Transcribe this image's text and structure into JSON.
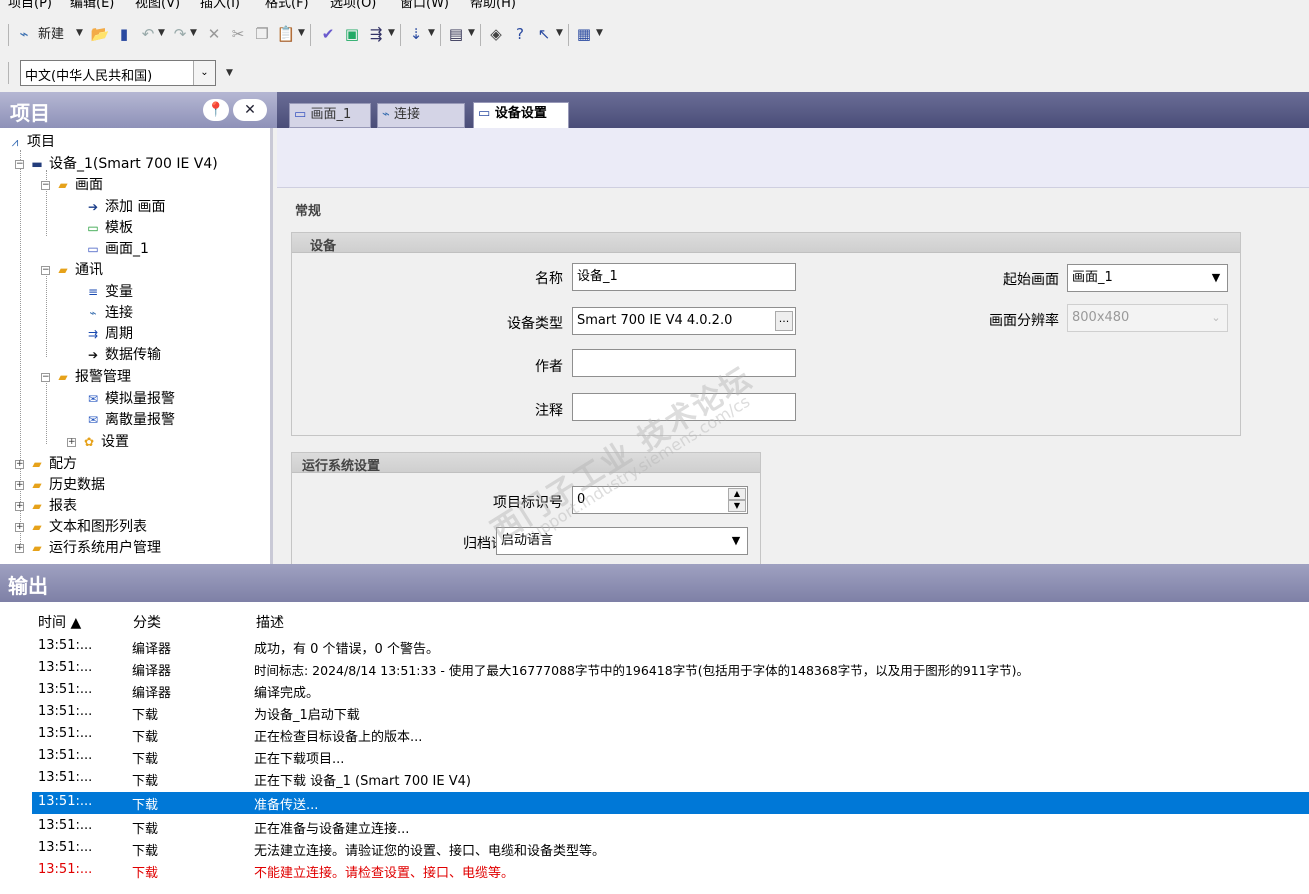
{
  "menu": [
    "项目(P)",
    "编辑(E)",
    "视图(V)",
    "插入(I)",
    "格式(F)",
    "选项(O)",
    "窗口(W)",
    "帮助(H)"
  ],
  "toolbar": {
    "new_label": "新建",
    "language": "中文(中华人民共和国)"
  },
  "project": {
    "title": "项目",
    "tree": {
      "root": "项目",
      "device": "设备_1(Smart 700 IE V4)",
      "screens": "画面",
      "add_screen": "添加 画面",
      "template": "模板",
      "screen_1": "画面_1",
      "comm": "通讯",
      "tags": "变量",
      "connections": "连接",
      "cycles": "周期",
      "transfer": "数据传输",
      "alarm_mgmt": "报警管理",
      "analog_alarms": "模拟量报警",
      "discrete_alarms": "离散量报警",
      "settings": "设置",
      "recipes": "配方",
      "history": "历史数据",
      "reports": "报表",
      "text_graphic_lists": "文本和图形列表",
      "runtime_users": "运行系统用户管理"
    }
  },
  "editor": {
    "tabs": [
      {
        "label": "画面_1"
      },
      {
        "label": "连接"
      },
      {
        "label": "设备设置"
      }
    ],
    "section_general": "常规",
    "group_device": "设备",
    "name_label": "名称",
    "name_value": "设备_1",
    "type_label": "设备类型",
    "type_value": "Smart 700 IE V4 4.0.2.0",
    "type_button": "...",
    "author_label": "作者",
    "author_value": "",
    "comment_label": "注释",
    "comment_value": "",
    "start_screen_label": "起始画面",
    "start_screen_value": "画面_1",
    "resolution_label": "画面分辨率",
    "resolution_value": "800x480",
    "group_runtime": "运行系统设置",
    "project_id_label": "项目标识号",
    "project_id_value": "0",
    "archive_lang_label": "归档语言",
    "archive_lang_value": "启动语言"
  },
  "watermark": {
    "line1": "西门子工业 技术论坛",
    "line2": "support.industry.siemens.com/cs"
  },
  "output": {
    "title": "输出",
    "columns": {
      "time": "时间 ▲",
      "category": "分类",
      "description": "描述"
    },
    "rows": [
      {
        "time": "13:51:...",
        "category": "编译器",
        "description": "成功，有 0 个错误，0 个警告。"
      },
      {
        "time": "13:51:...",
        "category": "编译器",
        "description": "时间标志: 2024/8/14 13:51:33 - 使用了最大16777088字节中的196418字节(包括用于字体的148368字节，以及用于图形的911字节)。"
      },
      {
        "time": "13:51:...",
        "category": "编译器",
        "description": "编译完成。"
      },
      {
        "time": "13:51:...",
        "category": "下载",
        "description": "为设备_1启动下载"
      },
      {
        "time": "13:51:...",
        "category": "下载",
        "description": "正在检查目标设备上的版本..."
      },
      {
        "time": "13:51:...",
        "category": "下载",
        "description": "正在下载项目..."
      },
      {
        "time": "13:51:...",
        "category": "下载",
        "description": "正在下载 设备_1 (Smart 700 IE V4)"
      },
      {
        "time": "13:51:...",
        "category": "下载",
        "description": "准备传送..."
      },
      {
        "time": "13:51:...",
        "category": "下载",
        "description": "正在准备与设备建立连接..."
      },
      {
        "time": "13:51:...",
        "category": "下载",
        "description": "无法建立连接。请验证您的设置、接口、电缆和设备类型等。"
      },
      {
        "time": "13:51:...",
        "category": "下载",
        "description": "不能建立连接。请检查设置、接口、电缆等。"
      }
    ]
  }
}
